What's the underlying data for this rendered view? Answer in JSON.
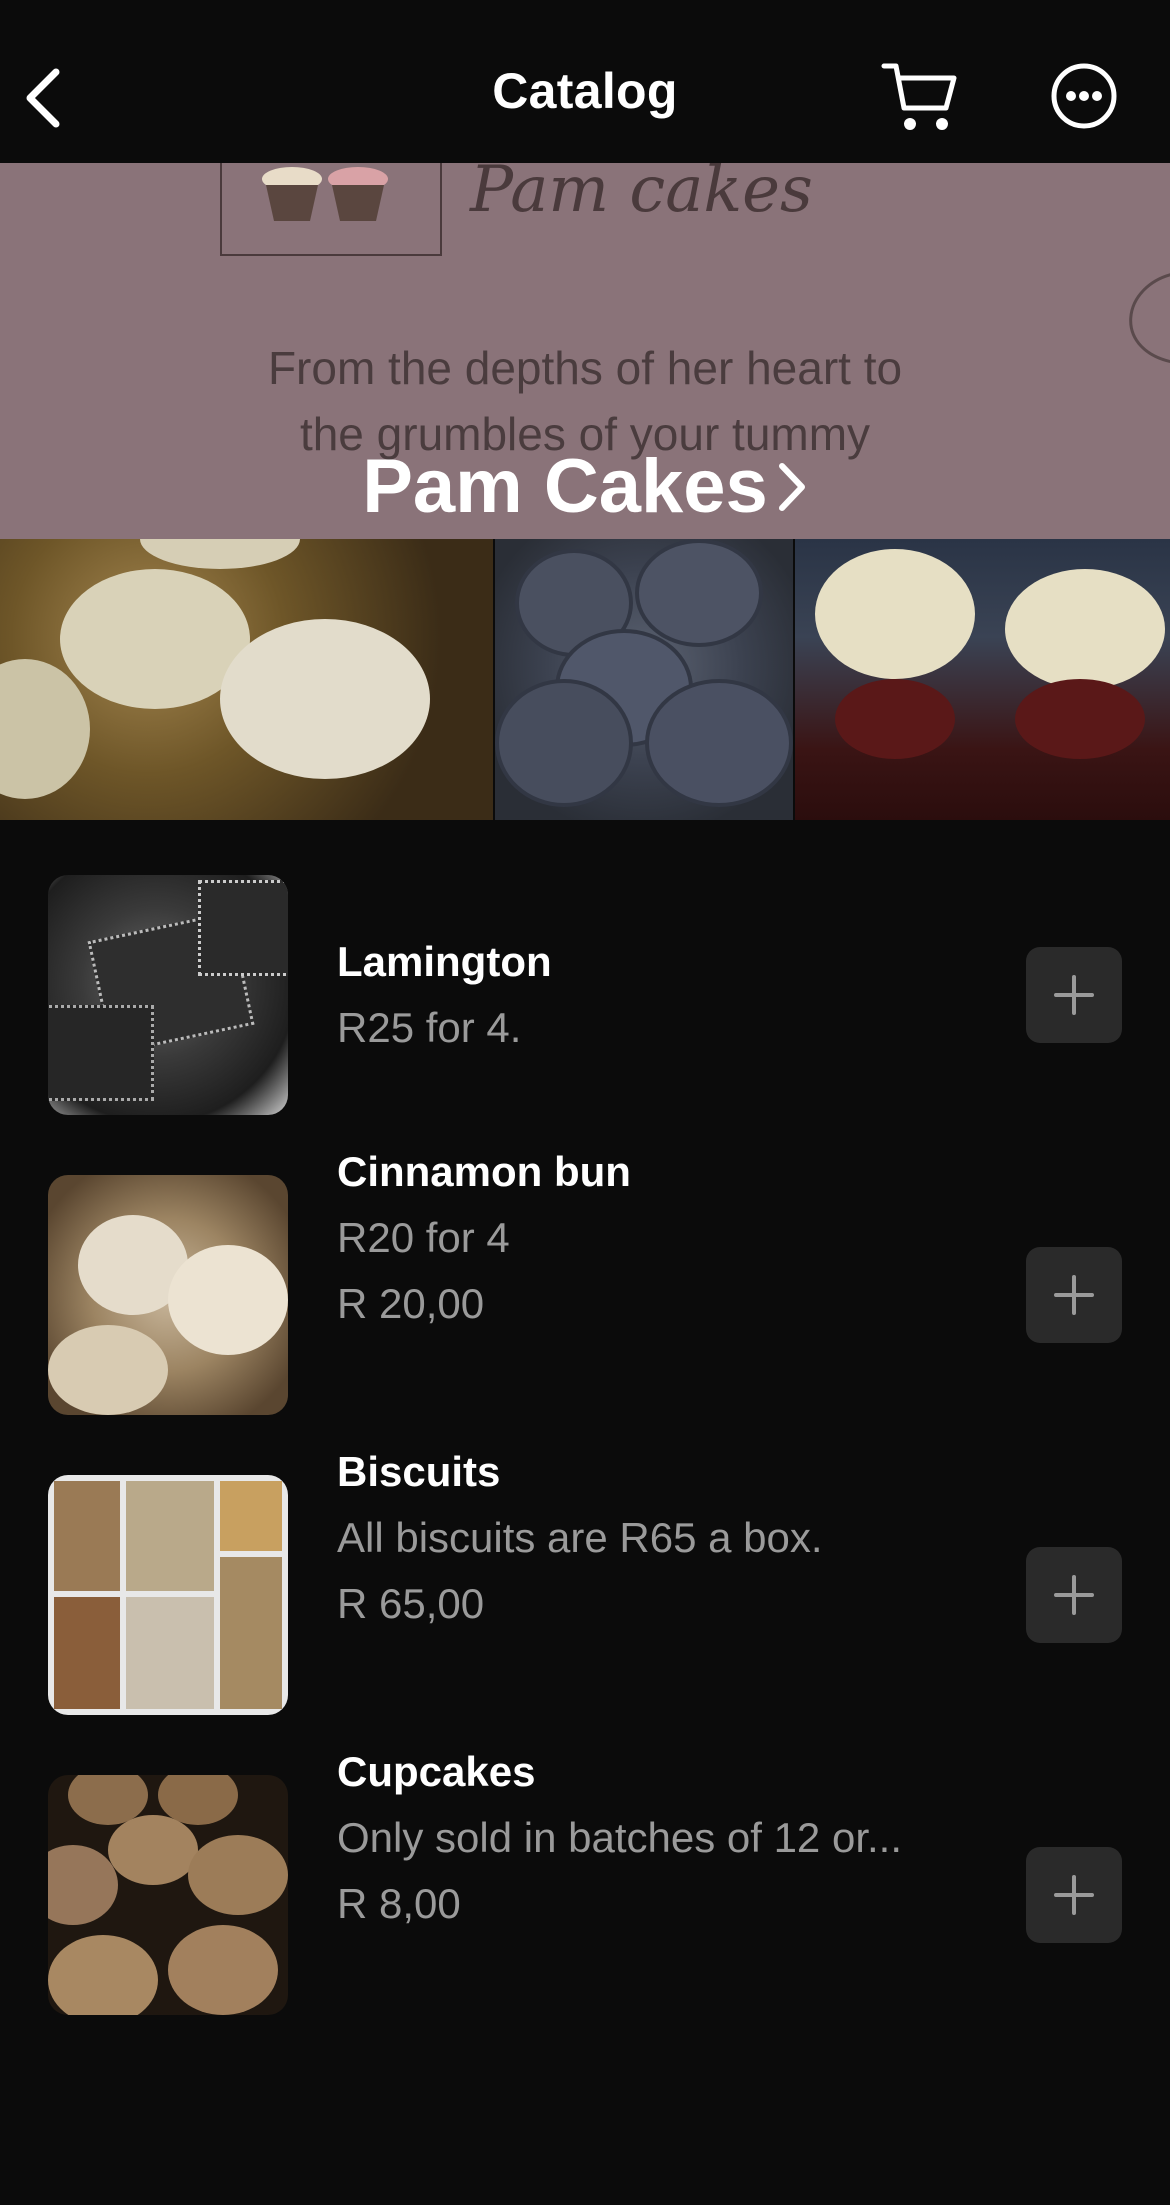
{
  "header": {
    "title": "Catalog",
    "back_icon": "chevron-left-icon",
    "cart_icon": "cart-icon",
    "more_icon": "more-horizontal-icon"
  },
  "banner": {
    "logo_text": "Pam cakes",
    "tagline_line1": "From the depths of her heart to",
    "tagline_line2": "the grumbles of your tummy",
    "store_name": "Pam Cakes",
    "background_color": "#8a7379"
  },
  "products": [
    {
      "name": "Lamington",
      "description": "R25 for 4.",
      "price": ""
    },
    {
      "name": "Cinnamon bun",
      "description": "R20 for 4",
      "price": "R 20,00"
    },
    {
      "name": "Biscuits",
      "description": "All biscuits are R65 a box.",
      "price": "R 65,00"
    },
    {
      "name": "Cupcakes",
      "description": "Only sold in batches of 12 or...",
      "price": "R 8,00"
    }
  ],
  "colors": {
    "background": "#0b0b0b",
    "secondary_text": "#9a9a9a",
    "add_button": "#2a2a2a"
  }
}
